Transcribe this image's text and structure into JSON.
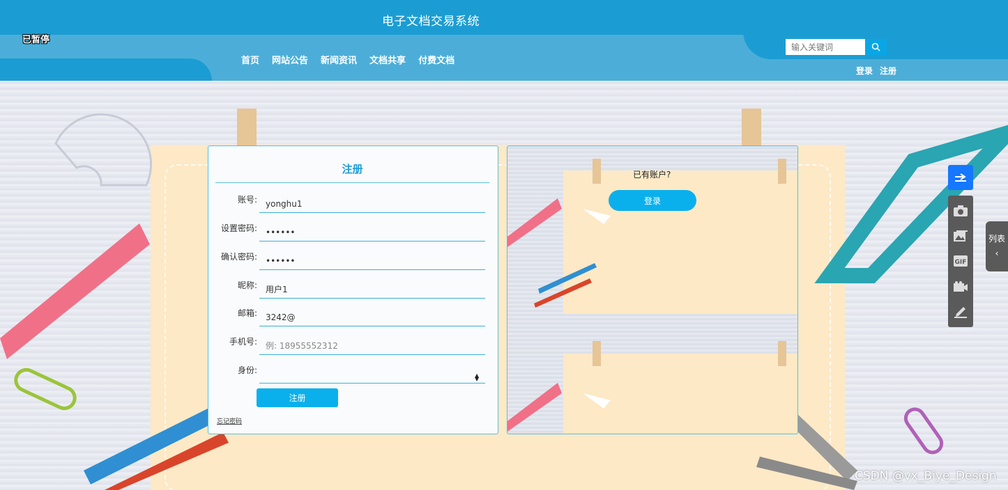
{
  "header": {
    "title": "电子文档交易系统",
    "paused_label": "已暂停",
    "nav": [
      "首页",
      "网站公告",
      "新闻资讯",
      "文档共享",
      "付费文档"
    ],
    "search_placeholder": "输入关键词",
    "login_link": "登录",
    "register_link": "注册"
  },
  "register_form": {
    "title": "注册",
    "fields": [
      {
        "label": "账号:",
        "value": "yonghu1",
        "type": "text"
      },
      {
        "label": "设置密码:",
        "value": "111111",
        "type": "password"
      },
      {
        "label": "确认密码:",
        "value": "111111",
        "type": "password"
      },
      {
        "label": "昵称:",
        "value": "用户1",
        "type": "text"
      },
      {
        "label": "邮箱:",
        "value": "3242@",
        "type": "text"
      },
      {
        "label": "手机号:",
        "value": "",
        "placeholder": "例: 18955552312",
        "type": "text"
      },
      {
        "label": "身份:",
        "value": "",
        "type": "select"
      }
    ],
    "submit_label": "注册",
    "forgot_label": "忘记密码"
  },
  "login_side": {
    "prompt": "已有账户?",
    "login_label": "登录"
  },
  "toolbar": {
    "side_tab_label": "列表",
    "icons": [
      "share-icon",
      "camera-icon",
      "image-icon",
      "gif-icon",
      "video-icon",
      "pen-icon"
    ]
  },
  "watermark": "CSDN @vx_Biye_Design",
  "colors": {
    "header": "#1b9dd3",
    "header_band": "#4caed8",
    "accent": "#0ab0ec",
    "paper": "#fde9c6"
  }
}
